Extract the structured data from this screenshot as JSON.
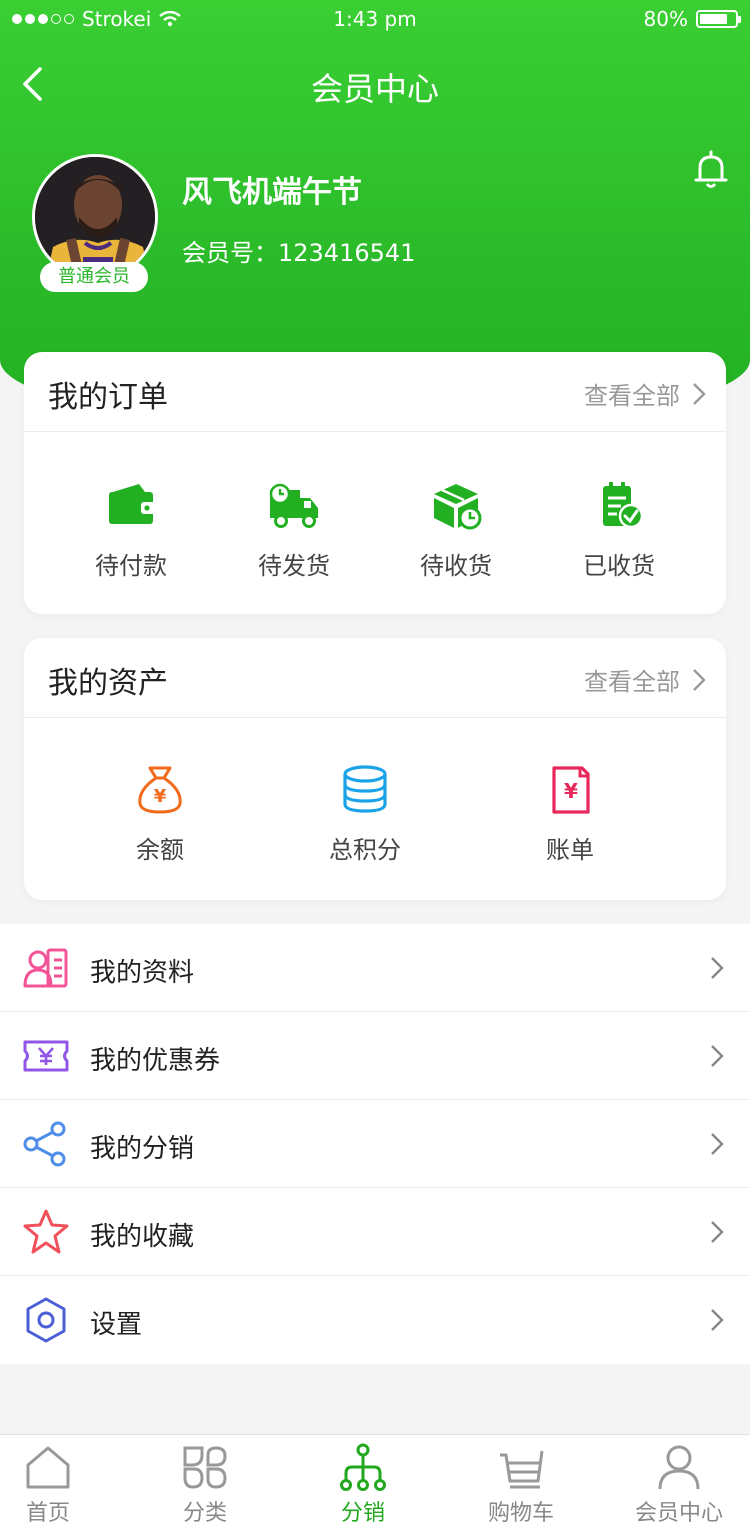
{
  "status": {
    "carrier": "Strokei",
    "time": "1:43 pm",
    "battery": "80%",
    "battery_level": 0.8
  },
  "nav": {
    "title": "会员中心"
  },
  "profile": {
    "name": "风飞机端午节",
    "member_no": "会员号：123416541",
    "level": "普通会员"
  },
  "orders": {
    "title": "我的订单",
    "more": "查看全部",
    "items": [
      {
        "label": "待付款",
        "icon": "wallet-icon"
      },
      {
        "label": "待发货",
        "icon": "truck-icon"
      },
      {
        "label": "待收货",
        "icon": "box-icon"
      },
      {
        "label": "已收货",
        "icon": "clipboard-check-icon"
      }
    ]
  },
  "assets": {
    "title": "我的资产",
    "more": "查看全部",
    "items": [
      {
        "label": "余额",
        "icon": "money-bag-icon"
      },
      {
        "label": "总积分",
        "icon": "coins-icon"
      },
      {
        "label": "账单",
        "icon": "bill-icon"
      }
    ]
  },
  "menu": [
    {
      "label": "我的资料",
      "icon": "profile-card-icon"
    },
    {
      "label": "我的优惠券",
      "icon": "coupon-icon"
    },
    {
      "label": "我的分销",
      "icon": "share-icon"
    },
    {
      "label": "我的收藏",
      "icon": "star-icon"
    },
    {
      "label": "设置",
      "icon": "settings-icon"
    }
  ],
  "tabs": [
    {
      "label": "首页",
      "icon": "home-icon"
    },
    {
      "label": "分类",
      "icon": "category-icon"
    },
    {
      "label": "分销",
      "icon": "distribution-icon"
    },
    {
      "label": "购物车",
      "icon": "cart-icon"
    },
    {
      "label": "会员中心",
      "icon": "user-icon"
    }
  ],
  "colors": {
    "primary": "#2bbb2a",
    "tab_active": "#22a81f",
    "balance": "#f26a1b",
    "points": "#1aa3e8",
    "bill": "#e8275a"
  }
}
